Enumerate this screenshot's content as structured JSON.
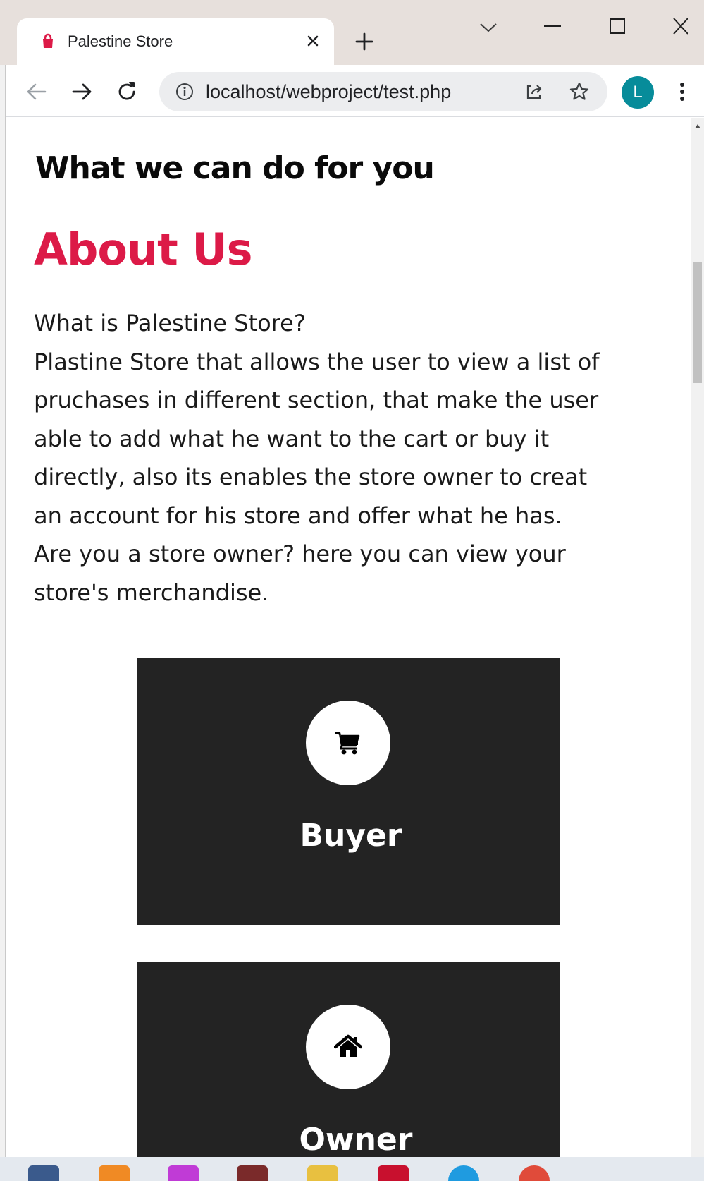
{
  "browser": {
    "tab_title": "Palestine Store",
    "url": "localhost/webproject/test.php",
    "profile_initial": "L",
    "colors": {
      "profile": "#078c9a",
      "tab_strip": "#e7e0dc",
      "omnibox": "#ecedef"
    }
  },
  "page": {
    "section_heading": "What we can do for you",
    "about": {
      "title": "About Us",
      "lines": [
        "What is Palestine Store?",
        "Plastine Store that allows the user to view a list of",
        "pruchases in different section, that make the user",
        "able to add what he want to the cart or buy it",
        "directly, also its enables the store owner to creat",
        "an account for his store and offer what he has.",
        "Are you a store owner? here you can view your",
        "store's merchandise."
      ]
    },
    "cards": [
      {
        "label": "Buyer",
        "icon": "shopping-cart-icon"
      },
      {
        "label": "Owner",
        "icon": "home-icon"
      }
    ],
    "colors": {
      "accent": "#dc1a47",
      "card_background": "#232323"
    }
  },
  "taskbar": {
    "apps": [
      "file-explorer-icon",
      "xampp-icon",
      "phpstorm-icon",
      "app-icon",
      "folder-icon",
      "mcafee-icon",
      "edge-icon",
      "chrome-icon"
    ]
  }
}
